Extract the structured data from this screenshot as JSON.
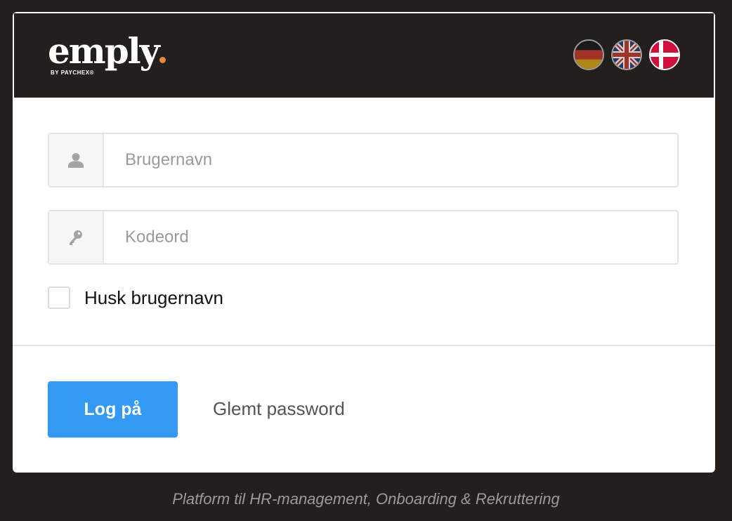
{
  "brand": {
    "logo_text": "emply",
    "logo_subtext": "BY PAYCHEX®",
    "accent_dot_color": "#e6883f"
  },
  "languages": [
    {
      "code": "de",
      "label": "Deutsch",
      "icon": "german-flag-icon",
      "active": false
    },
    {
      "code": "en",
      "label": "English",
      "icon": "uk-flag-icon",
      "active": false
    },
    {
      "code": "da",
      "label": "Dansk",
      "icon": "danish-flag-icon",
      "active": true
    }
  ],
  "login": {
    "username_placeholder": "Brugernavn",
    "username_value": "",
    "username_icon": "user-icon",
    "password_placeholder": "Kodeord",
    "password_value": "",
    "password_icon": "key-icon",
    "remember_label": "Husk brugernavn",
    "remember_checked": false,
    "submit_label": "Log på",
    "forgot_label": "Glemt password"
  },
  "footer": {
    "tagline": "Platform til HR-management, Onboarding & Rekruttering"
  },
  "colors": {
    "background": "#231f1c",
    "primary_button": "#3399f3",
    "card": "#ffffff"
  }
}
